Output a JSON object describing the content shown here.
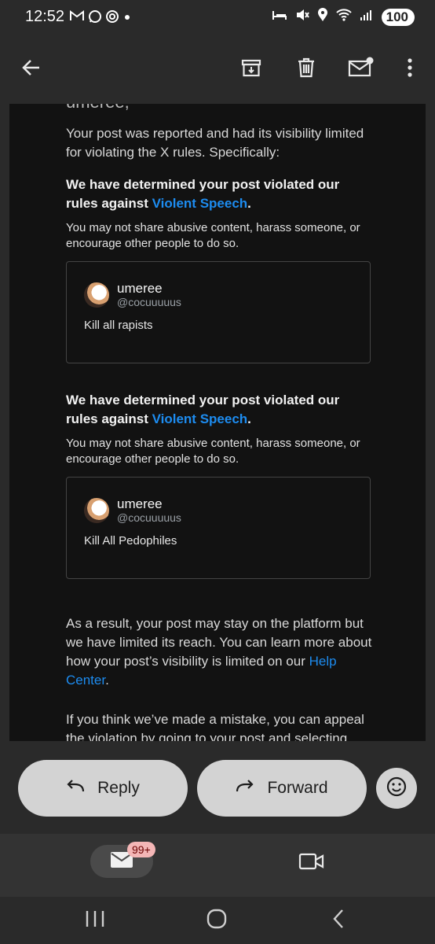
{
  "status_bar": {
    "time": "12:52",
    "left_icons": [
      "gmail-icon",
      "whatsapp-icon",
      "threads-icon",
      "dot-icon"
    ],
    "right_icons": [
      "bed-icon",
      "mute-icon",
      "location-icon",
      "wifi-icon",
      "signal-icon"
    ],
    "battery": "100"
  },
  "toolbar": {
    "back": "back-arrow-icon",
    "archive": "archive-icon",
    "delete": "delete-icon",
    "mark_unread": "mark-unread-icon",
    "more": "more-vert-icon"
  },
  "email": {
    "cut_text": "umeree,",
    "intro": "Your post was reported and had its visibility limited for violating the X rules. Specifically:",
    "violations": [
      {
        "heading_pre": "We have determined your post violated our rules against ",
        "heading_link": "Violent Speech",
        "heading_post": ".",
        "rule_text": "You may not share abusive content, harass someone, or encourage other people to do so.",
        "post": {
          "name": "umeree",
          "handle": "@cocuuuuus",
          "text": "Kill all rapists"
        }
      },
      {
        "heading_pre": "We have determined your post violated our rules against ",
        "heading_link": "Violent Speech",
        "heading_post": ".",
        "rule_text": "You may not share abusive content, harass someone, or encourage other people to do so.",
        "post": {
          "name": "umeree",
          "handle": "@cocuuuuus",
          "text": "Kill All Pedophiles"
        }
      }
    ],
    "result_pre": "As a result, your post may stay on the platform but we have limited its reach. You can learn more about how your post’s visibility is limited on our ",
    "result_link": "Help Center",
    "result_post": ".",
    "appeal_text": "If you think we’ve made a mistake, you can appeal the violation by going to your post and selecting “Learn"
  },
  "actions": {
    "reply": "Reply",
    "forward": "Forward"
  },
  "bottom_nav": {
    "mail_badge": "99+"
  },
  "colors": {
    "link": "#1d8cf0",
    "pill": "#d3d3d3",
    "background": "#121212"
  }
}
